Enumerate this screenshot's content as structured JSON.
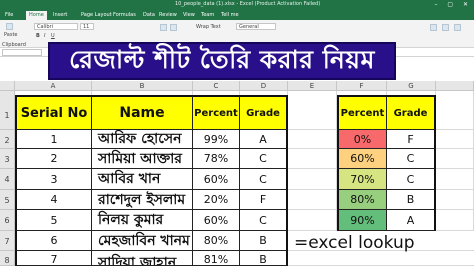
{
  "window": {
    "title": "10_people_data (1).xlsx - Excel (Product Activation Failed)",
    "controls": "–  ▢  ✕"
  },
  "ribbon_tabs": [
    "File",
    "Home",
    "Insert",
    "Page Layout",
    "Formulas",
    "Data",
    "Review",
    "View",
    "Team",
    "Tell me"
  ],
  "ribbon": {
    "clipboard_label": "Clipboard",
    "paste_label": "Paste",
    "font_name": "Calibri",
    "font_size": "11",
    "wrap_text_label": "Wrap Text",
    "number_format": "General"
  },
  "formula_bar": {
    "name_box": "",
    "fx": "fx"
  },
  "banner": {
    "text": "রেজাল্ট শীট তৈরি করার নিয়ম"
  },
  "columns": [
    "A",
    "B",
    "C",
    "D",
    "E",
    "F",
    "G"
  ],
  "rows": [
    "1",
    "2",
    "3",
    "4",
    "5",
    "6",
    "7",
    "8"
  ],
  "table": {
    "headers": {
      "serial": "Serial No",
      "name": "Name",
      "percent": "Percent",
      "grade": "Grade"
    },
    "records": [
      {
        "serial": "1",
        "name": "আরিফ হোসেন",
        "percent": "99%",
        "grade": "A"
      },
      {
        "serial": "2",
        "name": "সামিয়া আক্তার",
        "percent": "78%",
        "grade": "C"
      },
      {
        "serial": "3",
        "name": "আবির খান",
        "percent": "60%",
        "grade": "C"
      },
      {
        "serial": "4",
        "name": "রাশেদুল ইসলাম",
        "percent": "20%",
        "grade": "F"
      },
      {
        "serial": "5",
        "name": "নিলয় কুমার",
        "percent": "60%",
        "grade": "C"
      },
      {
        "serial": "6",
        "name": "মেহজাবিন খানম",
        "percent": "80%",
        "grade": "B"
      },
      {
        "serial": "7",
        "name": "সাদিয়া জাহান",
        "percent": "81%",
        "grade": "B"
      }
    ]
  },
  "lookup_table": {
    "headers": {
      "percent": "Percent",
      "grade": "Grade"
    },
    "rows": [
      {
        "percent": "0%",
        "grade": "F",
        "color": "#f8696b"
      },
      {
        "percent": "60%",
        "grade": "C",
        "color": "#fdd17f"
      },
      {
        "percent": "70%",
        "grade": "C",
        "color": "#d6e482"
      },
      {
        "percent": "80%",
        "grade": "B",
        "color": "#98cf7e"
      },
      {
        "percent": "90%",
        "grade": "A",
        "color": "#63be7b"
      }
    ]
  },
  "overlay_text": "=excel lookup",
  "colors": {
    "excel_green": "#217346",
    "banner_bg": "#2a0f8a",
    "header_yellow": "#ffff00"
  }
}
